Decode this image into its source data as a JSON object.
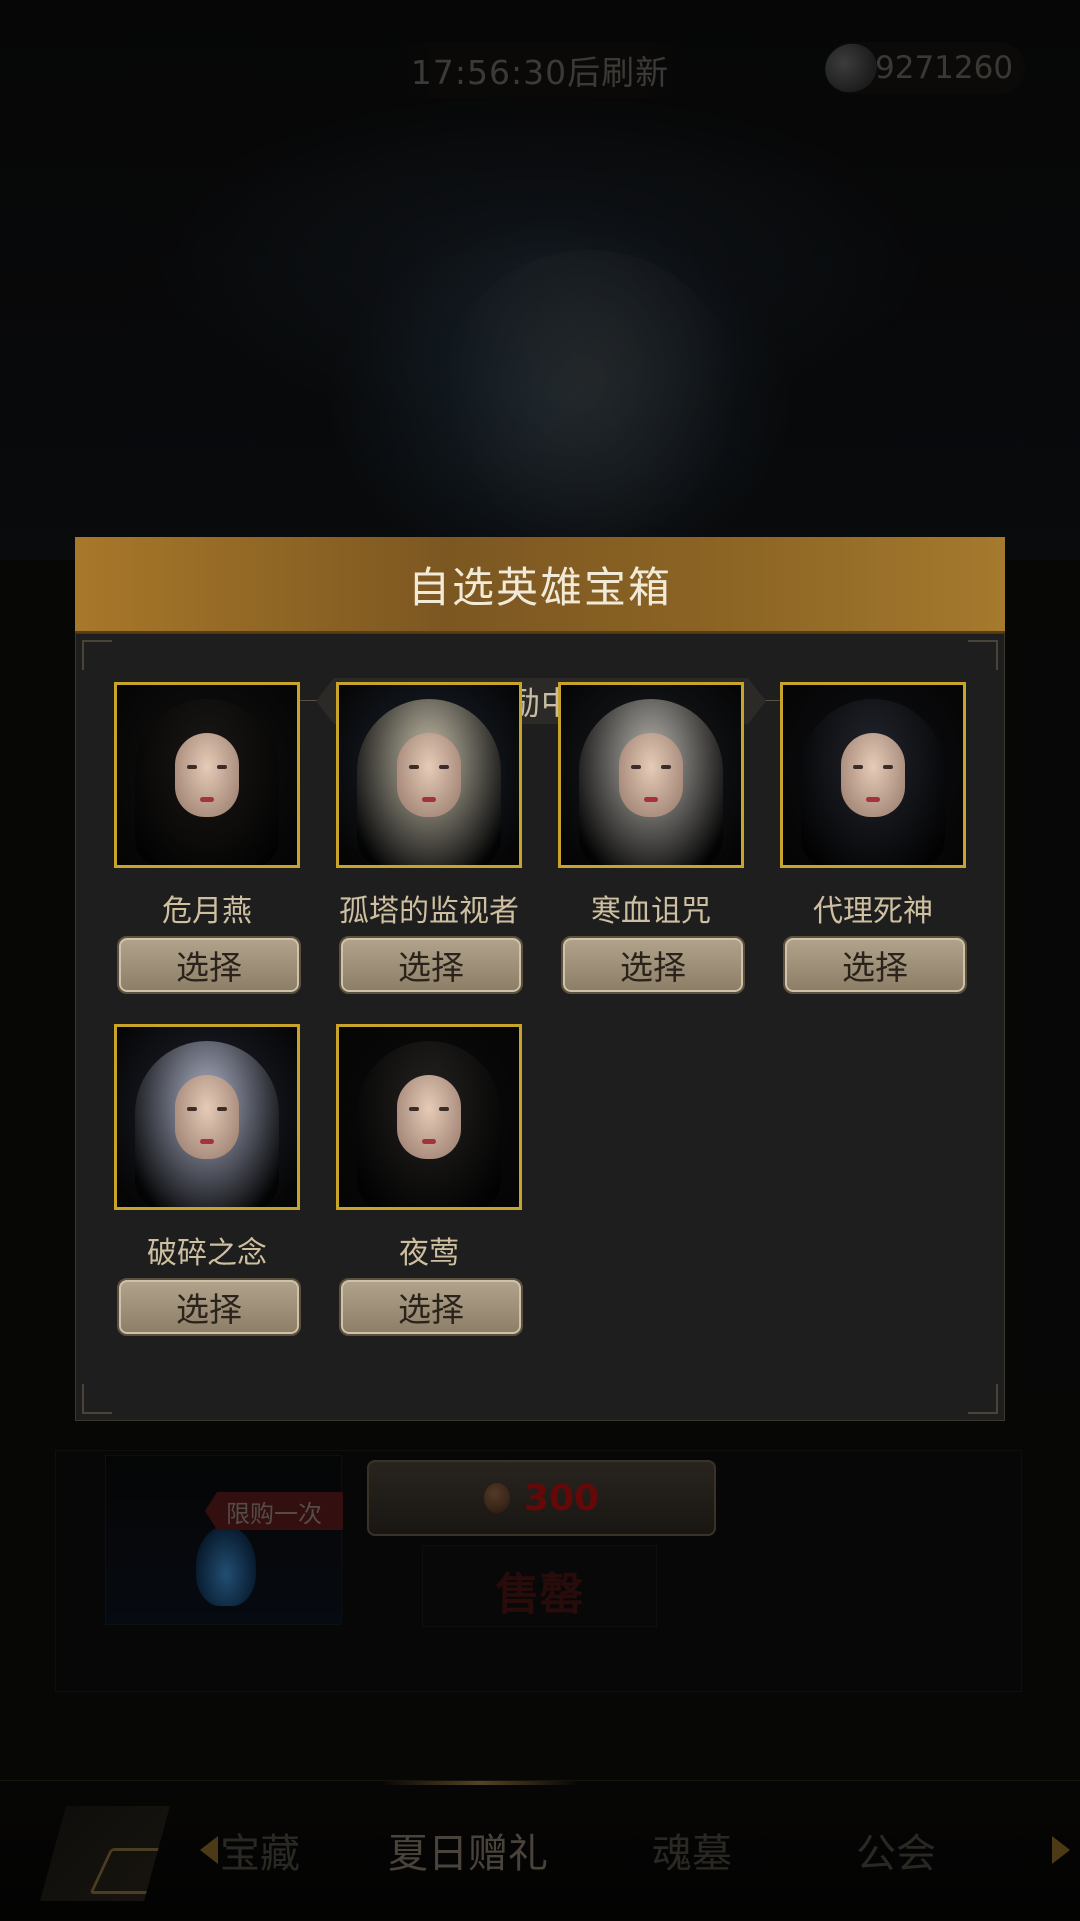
{
  "top_bar": {
    "refresh_timer": "17:56:30后刷新",
    "currency_value": "9271260"
  },
  "shop": {
    "limit_badge": "限购一次",
    "price": "300",
    "sold_out": "售罄"
  },
  "bottom_nav": {
    "tabs": [
      {
        "label": "宝藏"
      },
      {
        "label": "夏日赠礼"
      },
      {
        "label": "魂墓"
      },
      {
        "label": "公会"
      }
    ]
  },
  "modal": {
    "title": "自选英雄宝箱",
    "subtitle": "从以下奖励中选择一种",
    "select_label": "选择",
    "heroes": [
      {
        "name": "危月燕",
        "hair": "#1a1715",
        "bg": "#121110"
      },
      {
        "name": "孤塔的监视者",
        "hair": "#c4bca6",
        "bg": "#1c2430"
      },
      {
        "name": "寒血诅咒",
        "hair": "#b7b3ac",
        "bg": "#1a1d22"
      },
      {
        "name": "代理死神",
        "hair": "#22252d",
        "bg": "#0e0f14"
      },
      {
        "name": "破碎之念",
        "hair": "#a9aec2",
        "bg": "#222634"
      },
      {
        "name": "夜莺",
        "hair": "#242220",
        "bg": "#0b0b0b"
      }
    ]
  },
  "colors": {
    "header_gold": "#a8782a",
    "portrait_border": "#c8a42a",
    "price_red": "#b80f10"
  }
}
